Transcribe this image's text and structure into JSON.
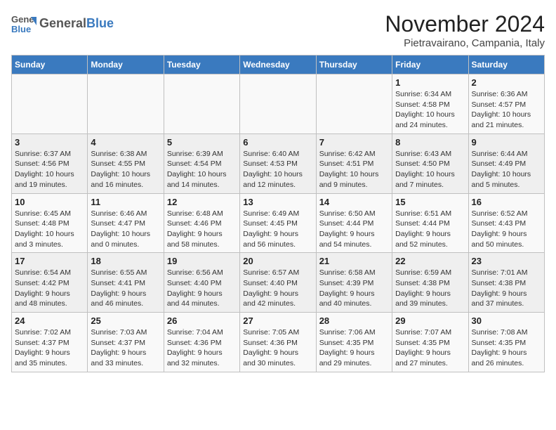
{
  "header": {
    "logo_general": "General",
    "logo_blue": "Blue",
    "title": "November 2024",
    "subtitle": "Pietravairano, Campania, Italy"
  },
  "columns": [
    "Sunday",
    "Monday",
    "Tuesday",
    "Wednesday",
    "Thursday",
    "Friday",
    "Saturday"
  ],
  "weeks": [
    [
      {
        "day": "",
        "info": ""
      },
      {
        "day": "",
        "info": ""
      },
      {
        "day": "",
        "info": ""
      },
      {
        "day": "",
        "info": ""
      },
      {
        "day": "",
        "info": ""
      },
      {
        "day": "1",
        "info": "Sunrise: 6:34 AM\nSunset: 4:58 PM\nDaylight: 10 hours\nand 24 minutes."
      },
      {
        "day": "2",
        "info": "Sunrise: 6:36 AM\nSunset: 4:57 PM\nDaylight: 10 hours\nand 21 minutes."
      }
    ],
    [
      {
        "day": "3",
        "info": "Sunrise: 6:37 AM\nSunset: 4:56 PM\nDaylight: 10 hours\nand 19 minutes."
      },
      {
        "day": "4",
        "info": "Sunrise: 6:38 AM\nSunset: 4:55 PM\nDaylight: 10 hours\nand 16 minutes."
      },
      {
        "day": "5",
        "info": "Sunrise: 6:39 AM\nSunset: 4:54 PM\nDaylight: 10 hours\nand 14 minutes."
      },
      {
        "day": "6",
        "info": "Sunrise: 6:40 AM\nSunset: 4:53 PM\nDaylight: 10 hours\nand 12 minutes."
      },
      {
        "day": "7",
        "info": "Sunrise: 6:42 AM\nSunset: 4:51 PM\nDaylight: 10 hours\nand 9 minutes."
      },
      {
        "day": "8",
        "info": "Sunrise: 6:43 AM\nSunset: 4:50 PM\nDaylight: 10 hours\nand 7 minutes."
      },
      {
        "day": "9",
        "info": "Sunrise: 6:44 AM\nSunset: 4:49 PM\nDaylight: 10 hours\nand 5 minutes."
      }
    ],
    [
      {
        "day": "10",
        "info": "Sunrise: 6:45 AM\nSunset: 4:48 PM\nDaylight: 10 hours\nand 3 minutes."
      },
      {
        "day": "11",
        "info": "Sunrise: 6:46 AM\nSunset: 4:47 PM\nDaylight: 10 hours\nand 0 minutes."
      },
      {
        "day": "12",
        "info": "Sunrise: 6:48 AM\nSunset: 4:46 PM\nDaylight: 9 hours\nand 58 minutes."
      },
      {
        "day": "13",
        "info": "Sunrise: 6:49 AM\nSunset: 4:45 PM\nDaylight: 9 hours\nand 56 minutes."
      },
      {
        "day": "14",
        "info": "Sunrise: 6:50 AM\nSunset: 4:44 PM\nDaylight: 9 hours\nand 54 minutes."
      },
      {
        "day": "15",
        "info": "Sunrise: 6:51 AM\nSunset: 4:44 PM\nDaylight: 9 hours\nand 52 minutes."
      },
      {
        "day": "16",
        "info": "Sunrise: 6:52 AM\nSunset: 4:43 PM\nDaylight: 9 hours\nand 50 minutes."
      }
    ],
    [
      {
        "day": "17",
        "info": "Sunrise: 6:54 AM\nSunset: 4:42 PM\nDaylight: 9 hours\nand 48 minutes."
      },
      {
        "day": "18",
        "info": "Sunrise: 6:55 AM\nSunset: 4:41 PM\nDaylight: 9 hours\nand 46 minutes."
      },
      {
        "day": "19",
        "info": "Sunrise: 6:56 AM\nSunset: 4:40 PM\nDaylight: 9 hours\nand 44 minutes."
      },
      {
        "day": "20",
        "info": "Sunrise: 6:57 AM\nSunset: 4:40 PM\nDaylight: 9 hours\nand 42 minutes."
      },
      {
        "day": "21",
        "info": "Sunrise: 6:58 AM\nSunset: 4:39 PM\nDaylight: 9 hours\nand 40 minutes."
      },
      {
        "day": "22",
        "info": "Sunrise: 6:59 AM\nSunset: 4:38 PM\nDaylight: 9 hours\nand 39 minutes."
      },
      {
        "day": "23",
        "info": "Sunrise: 7:01 AM\nSunset: 4:38 PM\nDaylight: 9 hours\nand 37 minutes."
      }
    ],
    [
      {
        "day": "24",
        "info": "Sunrise: 7:02 AM\nSunset: 4:37 PM\nDaylight: 9 hours\nand 35 minutes."
      },
      {
        "day": "25",
        "info": "Sunrise: 7:03 AM\nSunset: 4:37 PM\nDaylight: 9 hours\nand 33 minutes."
      },
      {
        "day": "26",
        "info": "Sunrise: 7:04 AM\nSunset: 4:36 PM\nDaylight: 9 hours\nand 32 minutes."
      },
      {
        "day": "27",
        "info": "Sunrise: 7:05 AM\nSunset: 4:36 PM\nDaylight: 9 hours\nand 30 minutes."
      },
      {
        "day": "28",
        "info": "Sunrise: 7:06 AM\nSunset: 4:35 PM\nDaylight: 9 hours\nand 29 minutes."
      },
      {
        "day": "29",
        "info": "Sunrise: 7:07 AM\nSunset: 4:35 PM\nDaylight: 9 hours\nand 27 minutes."
      },
      {
        "day": "30",
        "info": "Sunrise: 7:08 AM\nSunset: 4:35 PM\nDaylight: 9 hours\nand 26 minutes."
      }
    ]
  ]
}
